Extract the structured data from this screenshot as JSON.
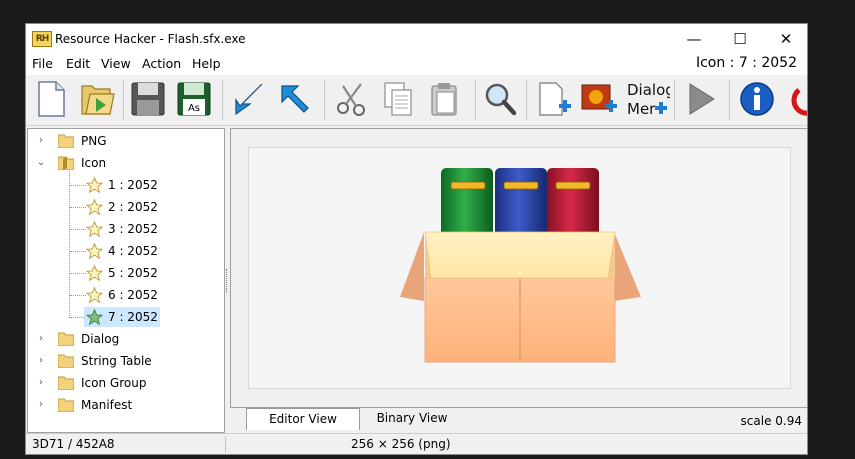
{
  "window": {
    "app_icon_text": "RH",
    "title": "Resource Hacker - Flash.sfx.exe",
    "minimize": "—",
    "maximize": "☐",
    "close": "✕"
  },
  "menu": {
    "items": [
      "File",
      "Edit",
      "View",
      "Action",
      "Help"
    ],
    "resource_id": "Icon : 7 : 2052"
  },
  "toolbar": {
    "dialog_merge_line1": "Dialog",
    "dialog_merge_line2": "Mer"
  },
  "tree": {
    "items": [
      {
        "label": "PNG",
        "expanded": false
      },
      {
        "label": "Icon",
        "expanded": true,
        "children": [
          "1 : 2052",
          "2 : 2052",
          "3 : 2052",
          "4 : 2052",
          "5 : 2052",
          "6 : 2052",
          "7 : 2052"
        ],
        "selected_child": 6
      },
      {
        "label": "Dialog",
        "expanded": false
      },
      {
        "label": "String Table",
        "expanded": false
      },
      {
        "label": "Icon Group",
        "expanded": false
      },
      {
        "label": "Manifest",
        "expanded": false
      }
    ]
  },
  "tabs": {
    "editor": "Editor View",
    "binary": "Binary View",
    "scale": "scale 0.94"
  },
  "status": {
    "offset": "3D71 / 452A8",
    "dimensions": "256 × 256 (png)"
  },
  "colors": {
    "book_green": "#1a8f2e",
    "book_blue": "#2a45a6",
    "book_red": "#b71a36",
    "box": "#ffbf8a",
    "selection": "#cce8ff"
  }
}
